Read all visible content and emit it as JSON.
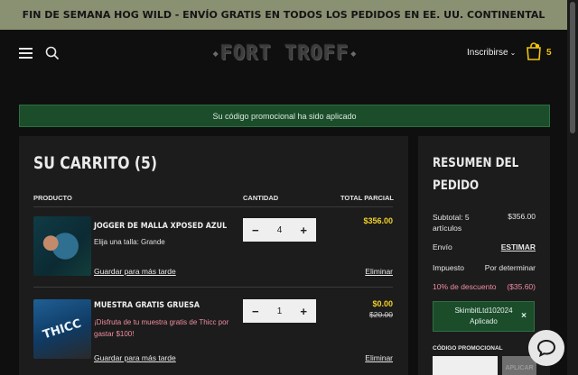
{
  "announcement": "FIN DE SEMANA HOG WILD - ENVÍO GRATIS EN TODOS LOS PEDIDOS EN EE. UU. CONTINENTAL",
  "header": {
    "logo": "FORT TROFF",
    "signup": "Inscribirse",
    "cart_count": "5"
  },
  "promo_banner": "Su código promocional ha sido aplicado",
  "cart": {
    "title": "SU CARRITO (5)",
    "columns": {
      "product": "PRODUCTO",
      "quantity": "CANTIDAD",
      "subtotal": "TOTAL PARCIAL"
    },
    "items": [
      {
        "name": "JOGGER DE MALLA XPOSED AZUL",
        "option": "Elija una talla: Grande",
        "save_later": "Guardar para más tarde",
        "remove": "Eliminar",
        "quantity": "4",
        "price": "$356.00"
      },
      {
        "name": "MUESTRA GRATIS GRUESA",
        "option": "¡Disfruta de tu muestra gratis de Thicc por gastar $100!",
        "save_later": "Guardar para más tarde",
        "remove": "Eliminar",
        "quantity": "1",
        "price": "$0.00",
        "price_old": "$20.00",
        "thumb_text": "THICC"
      }
    ]
  },
  "summary": {
    "title": "RESUMEN DEL PEDIDO",
    "subtotal_label": "Subtotal: 5 artículos",
    "subtotal_value": "$356.00",
    "shipping_label": "Envío",
    "shipping_value": "ESTIMAR",
    "tax_label": "Impuesto",
    "tax_value": "Por determinar",
    "discount_label": "10% de descuento",
    "discount_value": "($35.60)",
    "applied_code": "SkimbitLtd102024",
    "applied_status": "Aplicado",
    "promo_label": "CÓDIGO PROMOCIONAL",
    "apply_button": "APLICAR"
  },
  "colors": {
    "accent_yellow": "#f1d12a",
    "success_green": "#1b4d2b",
    "discount_pink": "#f08ca0",
    "announce_bg": "#8a9072"
  }
}
